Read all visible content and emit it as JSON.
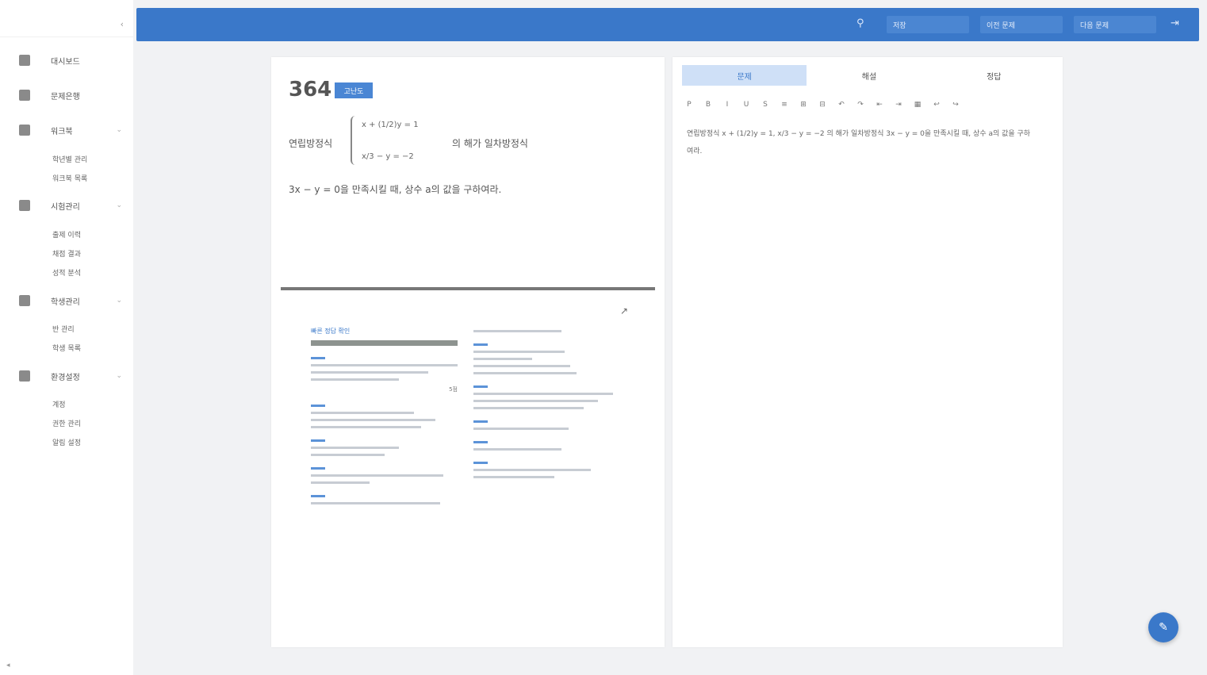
{
  "sidebar": {
    "collapse": "‹",
    "items": [
      {
        "label": "대시보드",
        "icon": "grid-icon"
      },
      {
        "label": "문제은행",
        "icon": "bank-icon"
      },
      {
        "label": "워크북",
        "icon": "book-icon",
        "chevron": "⌄",
        "sub": [
          "학년별 관리",
          "워크북 목록"
        ]
      },
      {
        "label": "시험관리",
        "icon": "exam-icon",
        "chevron": "⌄",
        "sub": [
          "출제 이력",
          "채점 결과",
          "성적 분석"
        ]
      },
      {
        "label": "학생관리",
        "icon": "student-icon",
        "chevron": "⌄",
        "sub": [
          "반 관리",
          "학생 목록"
        ]
      },
      {
        "label": "환경설정",
        "icon": "settings-icon",
        "chevron": "⌄",
        "sub": [
          "계정",
          "권한 관리",
          "알림 설정"
        ]
      }
    ],
    "bottom": "◂"
  },
  "header": {
    "search_icon": "⚲",
    "btn1": "저장",
    "btn2": "이전 문제",
    "btn3": "다음 문제",
    "exit_icon": "⇥"
  },
  "question": {
    "number": "364",
    "badge": "고난도",
    "intro": "연립방정식",
    "eq1": "x + (1/2)y = 1",
    "eq2": "x/3 − y = −2",
    "after": "의 해가 일차방정식",
    "line2": "3x − y = 0을 만족시킬 때, 상수 a의 값을 구하여라."
  },
  "thumb": {
    "left_title": "빠른 정답 확인",
    "score": "5점"
  },
  "right": {
    "tabs": [
      "문제",
      "해설",
      "정답"
    ],
    "tools": [
      "P",
      "B",
      "I",
      "U",
      "S",
      "≡",
      "⊞",
      "⊟",
      "↶",
      "↷",
      "⇤",
      "⇥",
      "▦",
      "↩",
      "↪"
    ],
    "editor_text": "연립방정식 x + (1/2)y = 1, x/3 − y = −2 의 해가 일차방정식 3x − y = 0을 만족시킬 때, 상수 a의 값을 구하",
    "editor_text2": "여라."
  },
  "fab": "✎"
}
